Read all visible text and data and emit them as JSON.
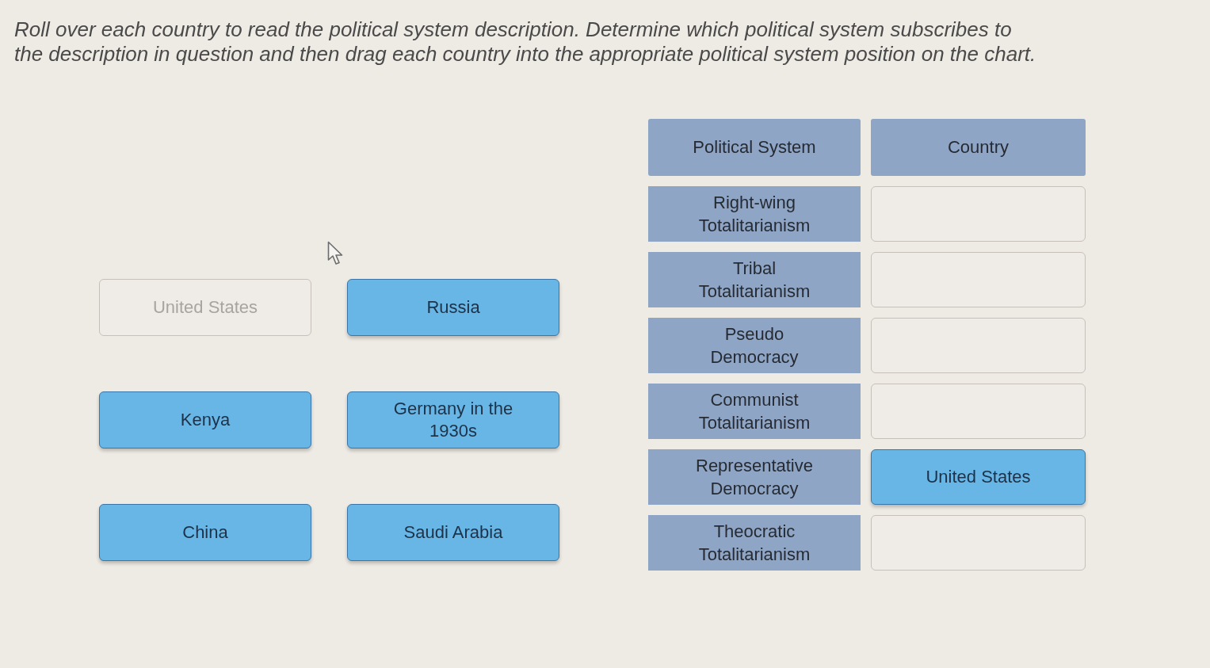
{
  "instructions": "Roll over each country to read the political system description. Determine which political system subscribes to the description in question and then drag each country into the appropriate political system position on the chart.",
  "countries": [
    {
      "label": "United States",
      "placed": true
    },
    {
      "label": "Kenya",
      "placed": false
    },
    {
      "label": "China",
      "placed": false
    },
    {
      "label": "Russia",
      "placed": false
    },
    {
      "label": "Germany in the 1930s",
      "placed": false
    },
    {
      "label": "Saudi Arabia",
      "placed": false
    }
  ],
  "chart": {
    "columns": [
      "Political System",
      "Country"
    ],
    "rows": [
      {
        "system": "Right-wing Totalitarianism"
      },
      {
        "system": "Tribal Totalitarianism"
      },
      {
        "system": "Pseudo Democracy"
      },
      {
        "system": "Communist Totalitarianism"
      },
      {
        "system": "Representative Democracy",
        "country": "United States"
      },
      {
        "system": "Theocratic Totalitarianism"
      }
    ]
  }
}
